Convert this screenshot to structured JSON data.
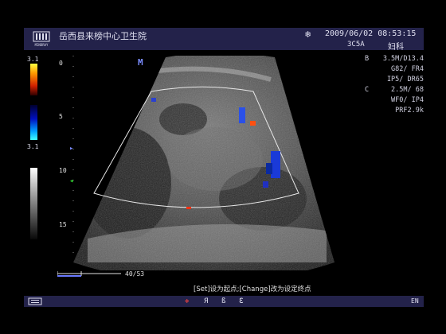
{
  "header": {
    "logo_text": "MINDRAY",
    "hospital": "岳西县来榜中心卫生院",
    "snowflake": "❄",
    "datetime": "2009/06/02 08:53:15",
    "probe": "3C5A",
    "preset": "妇科"
  },
  "params": [
    {
      "label": "B",
      "value": "3.5M/D13.4"
    },
    {
      "label": "",
      "value": "G82/ FR4"
    },
    {
      "label": "",
      "value": "IP5/ DR65"
    },
    {
      "label": "C",
      "value": "2.5M/ 68"
    },
    {
      "label": "",
      "value": "WF0/ IP4"
    },
    {
      "label": "",
      "value": "PRF2.9k"
    }
  ],
  "color_scale": {
    "top": "3.1",
    "bottom": "3.1"
  },
  "depth_ticks": [
    "0",
    "5",
    "10",
    "15"
  ],
  "mode_marker": "M",
  "cine": {
    "frames": "40/53"
  },
  "hint": "[Set]设为起点;[Change]改为设定终点",
  "bottom_bar": {
    "language": "EN",
    "icons": [
      "menu-icon",
      "rotate-icon",
      "a-mode-icon",
      "b-mode-icon",
      "c-mode-icon"
    ]
  },
  "colors": {
    "bar": "#23224a",
    "accent": "#7a8cff"
  }
}
